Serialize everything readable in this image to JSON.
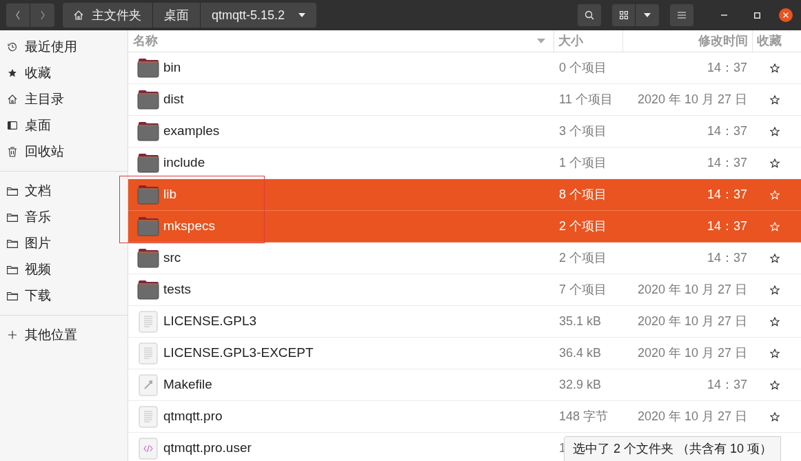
{
  "toolbar": {
    "path": [
      {
        "label": "主文件夹",
        "kind": "home"
      },
      {
        "label": "桌面",
        "kind": "plain"
      },
      {
        "label": "qtmqtt-5.15.2",
        "kind": "current"
      }
    ]
  },
  "sidebar": {
    "sections": [
      {
        "items": [
          {
            "label": "最近使用",
            "kind": "recent"
          },
          {
            "label": "收藏",
            "kind": "starred"
          },
          {
            "label": "主目录",
            "kind": "home"
          },
          {
            "label": "桌面",
            "kind": "desktop"
          },
          {
            "label": "回收站",
            "kind": "trash"
          }
        ]
      },
      {
        "items": [
          {
            "label": "文档",
            "kind": "folder"
          },
          {
            "label": "音乐",
            "kind": "folder"
          },
          {
            "label": "图片",
            "kind": "folder"
          },
          {
            "label": "视频",
            "kind": "folder"
          },
          {
            "label": "下载",
            "kind": "folder"
          }
        ]
      },
      {
        "items": [
          {
            "label": "其他位置",
            "kind": "other"
          }
        ]
      }
    ]
  },
  "table": {
    "columns": [
      "名称",
      "大小",
      "修改时间",
      "收藏"
    ],
    "rows": [
      {
        "name": "bin",
        "kind": "folder",
        "size": "0 个项目",
        "modified": "14：37",
        "starred": false,
        "selected": false
      },
      {
        "name": "dist",
        "kind": "folder",
        "size": "11 个项目",
        "modified": "2020 年 10 月 27 日",
        "starred": false,
        "selected": false
      },
      {
        "name": "examples",
        "kind": "folder",
        "size": "3 个项目",
        "modified": "14：37",
        "starred": false,
        "selected": false
      },
      {
        "name": "include",
        "kind": "folder",
        "size": "1 个项目",
        "modified": "14：37",
        "starred": false,
        "selected": false
      },
      {
        "name": "lib",
        "kind": "folder",
        "size": "8 个项目",
        "modified": "14：37",
        "starred": false,
        "selected": true
      },
      {
        "name": "mkspecs",
        "kind": "folder",
        "size": "2 个项目",
        "modified": "14：37",
        "starred": false,
        "selected": true
      },
      {
        "name": "src",
        "kind": "folder",
        "size": "2 个项目",
        "modified": "14：37",
        "starred": false,
        "selected": false
      },
      {
        "name": "tests",
        "kind": "folder",
        "size": "7 个项目",
        "modified": "2020 年 10 月 27 日",
        "starred": false,
        "selected": false
      },
      {
        "name": "LICENSE.GPL3",
        "kind": "text",
        "size": "35.1 kB",
        "modified": "2020 年 10 月 27 日",
        "starred": false,
        "selected": false
      },
      {
        "name": "LICENSE.GPL3-EXCEPT",
        "kind": "text",
        "size": "36.4 kB",
        "modified": "2020 年 10 月 27 日",
        "starred": false,
        "selected": false
      },
      {
        "name": "Makefile",
        "kind": "makefile",
        "size": "32.9 kB",
        "modified": "14：37",
        "starred": false,
        "selected": false
      },
      {
        "name": "qtmqtt.pro",
        "kind": "text",
        "size": "148 字节",
        "modified": "2020 年 10 月 27 日",
        "starred": false,
        "selected": false
      },
      {
        "name": "qtmqtt.pro.user",
        "kind": "code",
        "size": "1",
        "selected": false
      }
    ]
  },
  "status": "选中了 2 个文件夹 （共含有 10 项）"
}
